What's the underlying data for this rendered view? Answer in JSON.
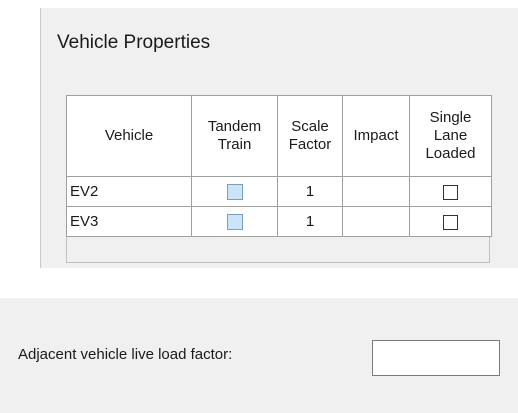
{
  "dialog": {
    "title": "Vehicle Properties"
  },
  "grid": {
    "columns": [
      {
        "key": "vehicle",
        "label": "Vehicle"
      },
      {
        "key": "tandem_train",
        "label": "Tandem Train"
      },
      {
        "key": "scale_factor",
        "label": "Scale Factor"
      },
      {
        "key": "impact",
        "label": "Impact"
      },
      {
        "key": "single_lane_loaded",
        "label": "Single Lane Loaded"
      }
    ],
    "rows": [
      {
        "vehicle": "EV2",
        "tandem_train": false,
        "scale_factor": "1",
        "impact": "",
        "single_lane_loaded": false
      },
      {
        "vehicle": "EV3",
        "tandem_train": false,
        "scale_factor": "1",
        "impact": "",
        "single_lane_loaded": false
      }
    ]
  },
  "adjacent_factor": {
    "label": "Adjacent vehicle live load factor:",
    "value": ""
  },
  "colors": {
    "panel_background": "#f0f0f0",
    "train_checkbox_fill": "#cce4f7",
    "grid_border": "#a0a0a0"
  }
}
